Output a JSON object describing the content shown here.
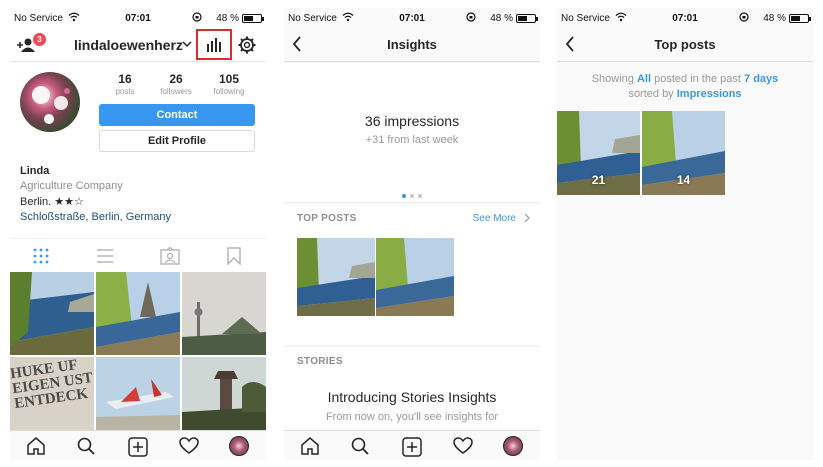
{
  "status_bar": {
    "carrier": "No Service",
    "time": "07:01",
    "battery": "48 %"
  },
  "profile": {
    "friend_request_count": "3",
    "username": "lindaloewenherz",
    "stats": [
      {
        "value": "16",
        "label": "posts"
      },
      {
        "value": "26",
        "label": "followers"
      },
      {
        "value": "105",
        "label": "following"
      }
    ],
    "contact_label": "Contact",
    "edit_profile_label": "Edit Profile",
    "bio": {
      "name": "Linda",
      "category": "Agriculture Company",
      "line": "Berlin. ★★☆",
      "location": "Schloßstraße, Berlin, Germany"
    },
    "grid_text": "HUKE UF EIGEN UST ENTDECK"
  },
  "insights": {
    "title": "Insights",
    "impressions": "36 impressions",
    "change": "+31 from last week",
    "top_posts_heading": "TOP POSTS",
    "see_more": "See More",
    "stories_heading": "STORIES",
    "stories_title": "Introducing Stories Insights",
    "stories_body": "From now on, you'll see insights for"
  },
  "top_posts": {
    "title": "Top posts",
    "showing_prefix": "Showing",
    "filter_all": "All",
    "posted_in": "posted in the past",
    "period": "7 days",
    "sorted_by": "sorted by",
    "sort_field": "Impressions",
    "posts": [
      {
        "count": "21"
      },
      {
        "count": "14"
      }
    ]
  },
  "icons": [
    "wifi-icon",
    "lock-rotation-icon",
    "battery-icon",
    "add-friend-icon",
    "chevron-down-icon",
    "bar-chart-icon",
    "gear-icon",
    "back-chevron-icon",
    "grid-icon",
    "list-icon",
    "tagged-icon",
    "bookmark-icon",
    "home-icon",
    "search-icon",
    "add-post-icon",
    "heart-icon"
  ],
  "colors": {
    "accent": "#3897f0",
    "highlight_box": "#d32f2f",
    "badge": "#ed4956"
  }
}
